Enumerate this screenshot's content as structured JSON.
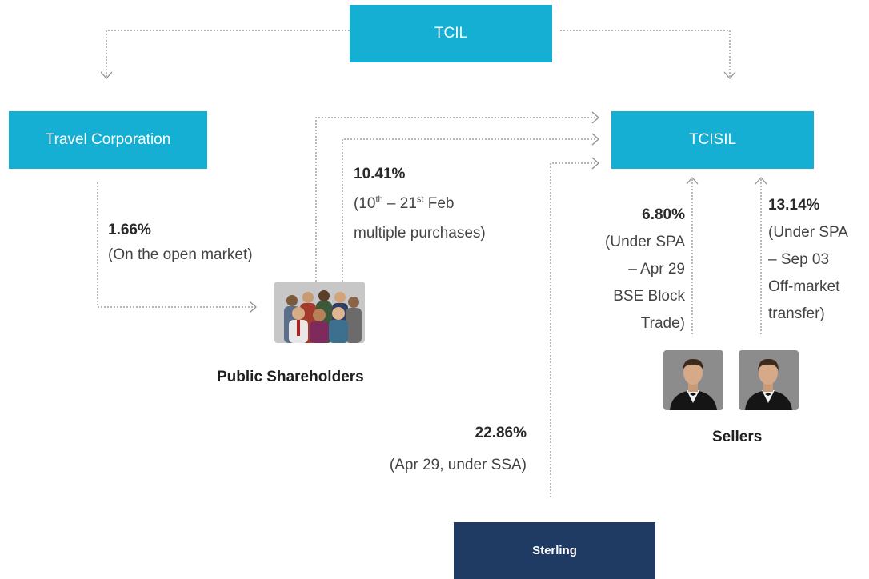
{
  "entities": {
    "tcil": "TCIL",
    "travel_corporation": "Travel Corporation",
    "tcisil": "TCISIL",
    "sterling": "Sterling",
    "public_shareholders": "Public Shareholders",
    "sellers": "Sellers"
  },
  "flows": {
    "open_market": {
      "pct": "1.66%",
      "note": "(On the open market)"
    },
    "multiple_purchases": {
      "pct": "10.41%",
      "open": "(10",
      "sup1": "th",
      "mid": " – 21",
      "sup2": "st",
      "end": " Feb",
      "line2": "multiple purchases)"
    },
    "spa_apr": {
      "pct": "6.80%",
      "line1": "(Under SPA",
      "line2": "– Apr 29",
      "line3": "BSE Block",
      "line4": "Trade)"
    },
    "spa_sep": {
      "pct": "13.14%",
      "line1": "(Under SPA",
      "line2": "– Sep 03",
      "line3": "Off-market",
      "line4": "transfer)"
    },
    "ssa": {
      "pct": "22.86%",
      "note": "(Apr 29, under SSA)"
    }
  },
  "icons": {
    "group": "people-group-icon",
    "seller": "businessman-icon"
  },
  "colors": {
    "box": "#14afd2",
    "sterling": "#1f3a63",
    "connector": "#8a8a8a"
  }
}
